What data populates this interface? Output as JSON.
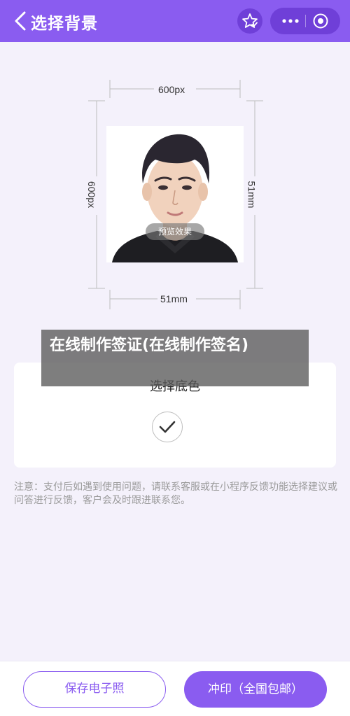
{
  "header": {
    "title": "选择背景",
    "back_icon": "chevron-left-icon",
    "favorite_icon": "star-check-icon",
    "more_icon": "more-dots-icon",
    "close_icon": "target-close-icon",
    "color": "#8a5cf0"
  },
  "preview": {
    "width_px_label": "600px",
    "height_px_label": "600px",
    "width_mm_label": "51mm",
    "height_mm_label": "51mm",
    "badge": "预览效果"
  },
  "watermark": {
    "text": "在线制作签证(在线制作签名)"
  },
  "color_picker": {
    "title": "选择底色",
    "selected_color": "#ffffff",
    "check_icon": "check-icon"
  },
  "notice": {
    "text": "注意：支付后如遇到使用问题，请联系客服或在小程序反馈功能选择建议或问答进行反馈，客户会及时跟进联系您。"
  },
  "actions": {
    "save_label": "保存电子照",
    "print_label": "冲印（全国包邮）",
    "accent": "#8a5cf0"
  }
}
